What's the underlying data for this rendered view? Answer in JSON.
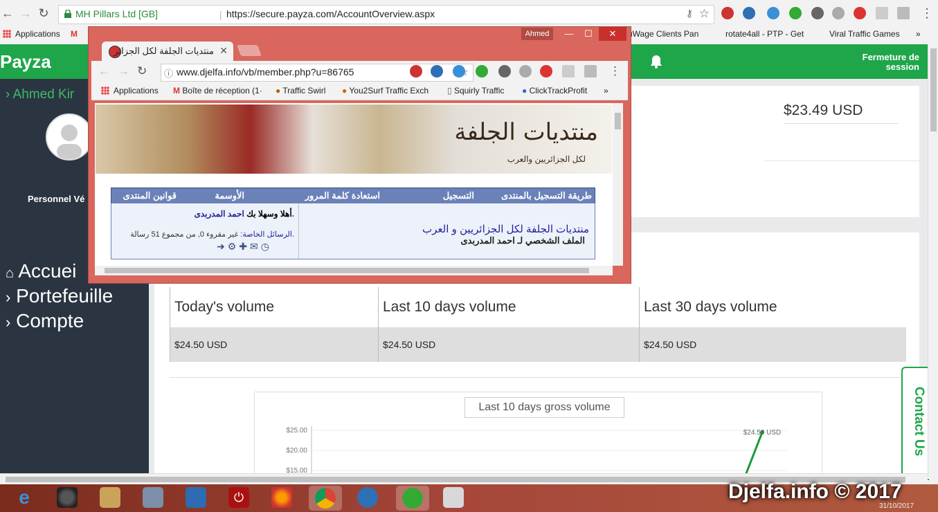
{
  "chrome": {
    "ev_label": "MH Pillars Ltd [GB]",
    "url": "https://secure.payza.com/AccountOverview.aspx",
    "bookmarks": [
      "Applications",
      "uWage Clients Pan",
      "rotate4all - PTP - Get",
      "Viral Traffic Games",
      "»"
    ]
  },
  "payza": {
    "logo": "Payza",
    "logout": "Fermeture de session",
    "user_name": "› Ahmed Kir",
    "verified": "Personnel Vé",
    "menu": [
      "Accuei",
      "Portefeuille",
      "Compte"
    ],
    "balance": "$23.49 USD",
    "volumes": {
      "headers": [
        "Today's volume",
        "Last 10 days volume",
        "Last 30 days volume"
      ],
      "values": [
        "$24.50 USD",
        "$24.50 USD",
        "$24.50 USD"
      ]
    },
    "contact": "Contact Us"
  },
  "chart_data": {
    "type": "line",
    "title": "Last 10 days gross volume",
    "y_ticks": [
      "$25.00",
      "$20.00",
      "$15.00"
    ],
    "ylim": [
      15,
      25
    ],
    "annotation": "$24.50 USD",
    "series": [
      {
        "values": [
          24.5
        ]
      }
    ]
  },
  "popup": {
    "user": "Ahmed",
    "tab_title": "منتديات الجلفة لكل الجزائر",
    "url": "www.djelfa.info/vb/member.php?u=86765",
    "bookmarks": [
      "Applications",
      "Boîte de réception (1·",
      "Traffic Swirl",
      "You2Surf Traffic Exch",
      "Squirly Traffic",
      "ClickTrackProfit",
      "»"
    ],
    "banner_logo": "منتديات الجلفة",
    "banner_tag": "لكل الجزائريين والعرب",
    "nav": [
      "طريقة التسجيل بالمنتدى",
      "التسجيل",
      "استعادة كلمة المرور",
      "الأوسمة",
      "قوانين المنتدى"
    ],
    "welcome_prefix": "أهلا وسهلا بك",
    "welcome_name": "احمد المدربدى.",
    "pm_label": "الرسائل الخاصة:",
    "pm_text": "غير مقروء 0, من مجموع 51 رسالة.",
    "crumb1": "منتديات الجلفة لكل الجزائريين و العرب",
    "crumb2": "الملف الشخصي لـ احمد المدربدى"
  },
  "taskbar": {
    "watermark": "Djelfa.info © 2017",
    "date": "31/10/2017"
  },
  "colors": {
    "payza_green": "#1fa64a",
    "sidebar": "#2b3542",
    "popup_frame": "#d9675d",
    "forum_blue": "#6a82b8"
  }
}
